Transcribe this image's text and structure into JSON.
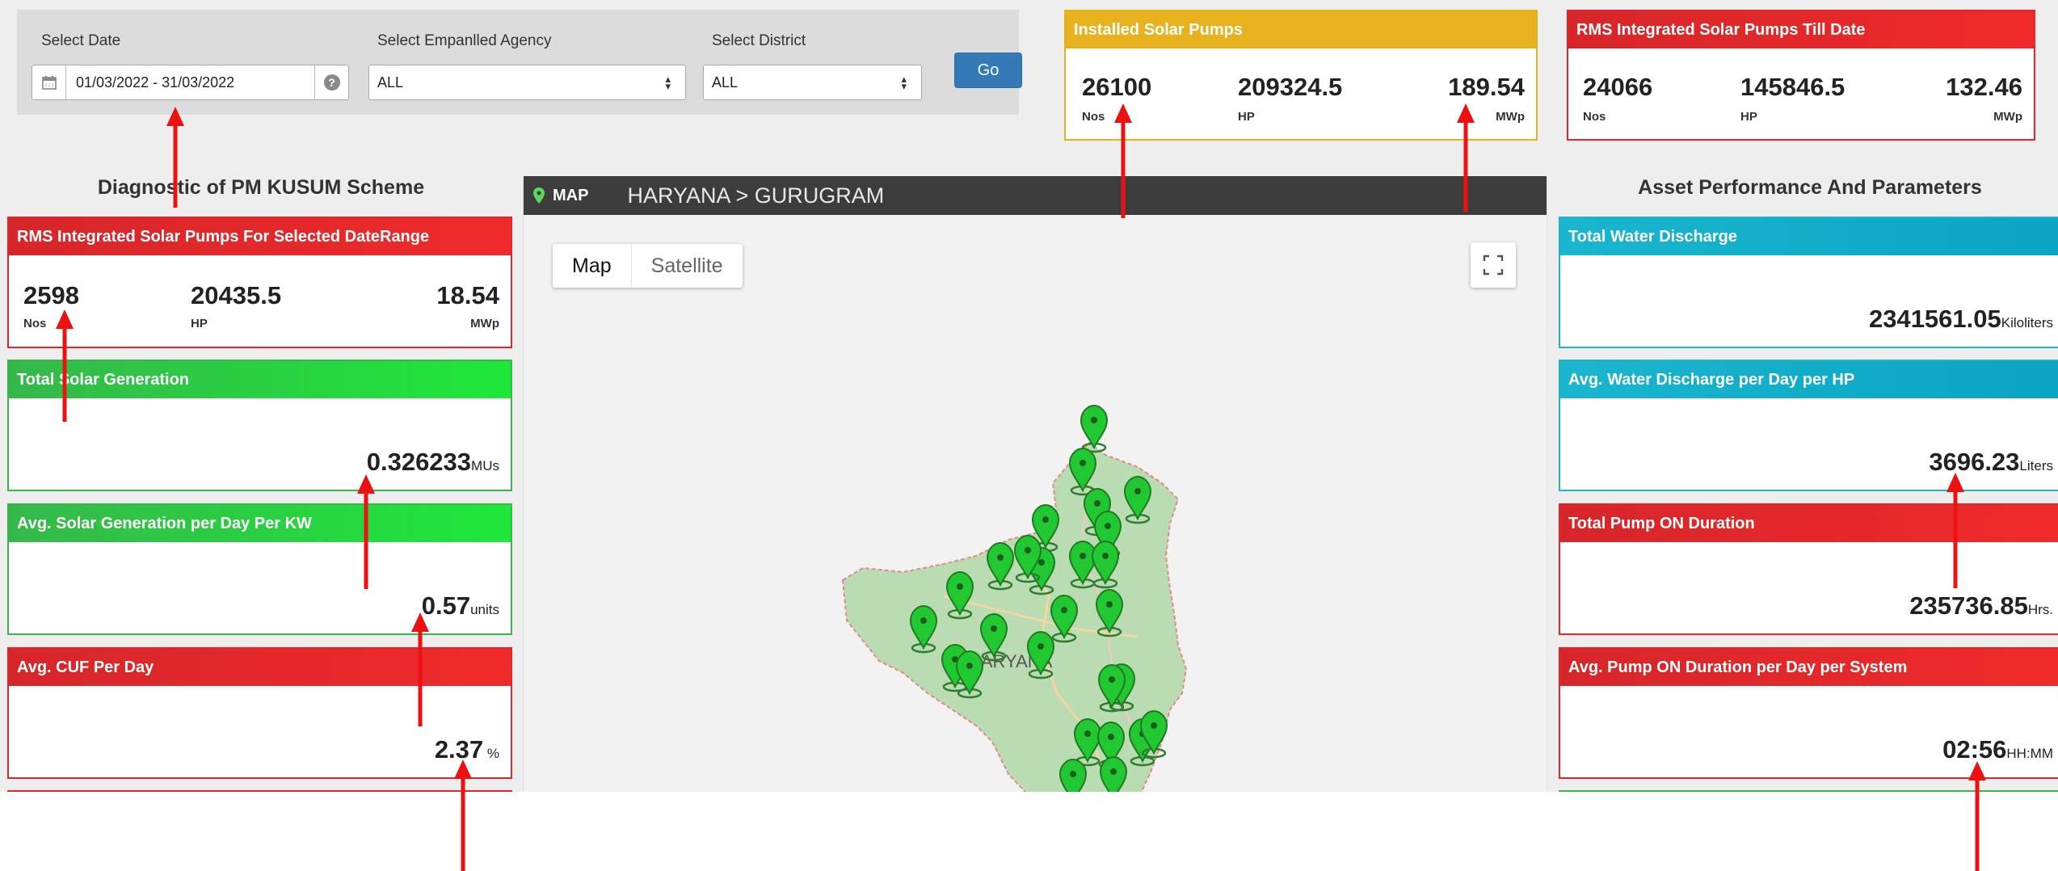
{
  "filters": {
    "date_label": "Select Date",
    "date_value": "01/03/2022 - 31/03/2022",
    "agency_label": "Select Empanlled Agency",
    "agency_value": "ALL",
    "district_label": "Select District",
    "district_value": "ALL",
    "go_label": "Go"
  },
  "installed": {
    "title": "Installed Solar Pumps",
    "nos": "26100",
    "nos_unit": "Nos",
    "hp": "209324.5",
    "hp_unit": "HP",
    "mwp": "189.54",
    "mwp_unit": "MWp"
  },
  "rms_till_date": {
    "title": "RMS Integrated Solar Pumps Till Date",
    "nos": "24066",
    "nos_unit": "Nos",
    "hp": "145846.5",
    "hp_unit": "HP",
    "mwp": "132.46",
    "mwp_unit": "MWp"
  },
  "left": {
    "section_title": "Diagnostic of PM KUSUM Scheme",
    "rms_range": {
      "title": "RMS Integrated Solar Pumps For Selected DateRange",
      "nos": "2598",
      "nos_unit": "Nos",
      "hp": "20435.5",
      "hp_unit": "HP",
      "mwp": "18.54",
      "mwp_unit": "MWp"
    },
    "solar_gen": {
      "title": "Total Solar Generation",
      "value": "0.326233",
      "unit": "MUs"
    },
    "avg_solar_gen": {
      "title": "Avg. Solar Generation per Day Per KW",
      "value": "0.57",
      "unit": "units"
    },
    "avg_cuf": {
      "title": "Avg. CUF Per Day",
      "value": "2.37",
      "unit": " %"
    }
  },
  "map": {
    "label": "MAP",
    "breadcrumb": "HARYANA  >  GURUGRAM",
    "map_btn": "Map",
    "satellite_btn": "Satellite",
    "place_label": "HARYANA"
  },
  "right": {
    "section_title": "Asset Performance And Parameters",
    "water_discharge": {
      "title": "Total Water Discharge",
      "value": "2341561.05",
      "unit": "Kiloliters"
    },
    "avg_water": {
      "title": "Avg. Water Discharge per Day per HP",
      "value": "3696.23",
      "unit": "Liters"
    },
    "pump_on": {
      "title": "Total Pump ON Duration",
      "value": "235736.85",
      "unit": "Hrs."
    },
    "avg_pump_on": {
      "title": "Avg. Pump ON Duration per Day per System",
      "value": "02:56",
      "unit": "HH:MM"
    }
  },
  "colors": {
    "red_header": "#e3262b",
    "green_header": "#22d83a",
    "cyan_header": "#14b0cb",
    "yellow_header": "#e8b21e",
    "go_button": "#337ab7",
    "annotation_arrow": "#ee1111",
    "marker": "#22c832"
  },
  "icons": {
    "calendar": "calendar-icon",
    "help": "question-circle-icon",
    "map_pin": "map-pin-icon",
    "fullscreen": "fullscreen-icon",
    "marker": "map-marker-icon"
  }
}
